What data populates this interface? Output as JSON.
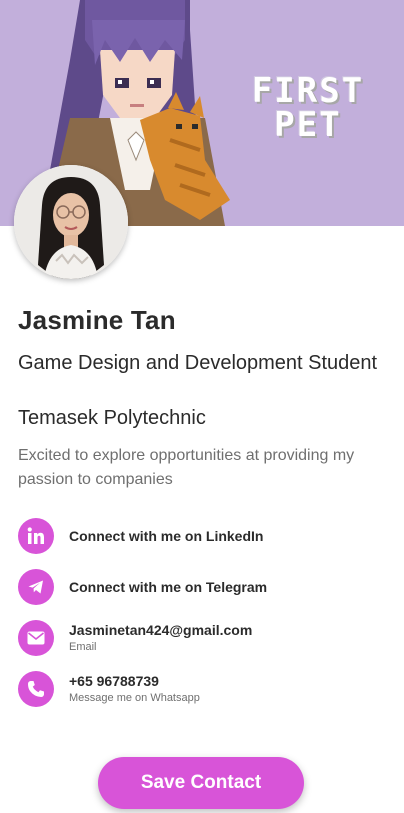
{
  "banner": {
    "title": "FIRST\nPET",
    "background_color": "#c2afdb"
  },
  "profile": {
    "name": "Jasmine Tan",
    "job_title": "Game Design and Development Student",
    "organization": "Temasek Polytechnic",
    "bio": "Excited to explore opportunities at providing my passion to companies"
  },
  "links": [
    {
      "icon": "linkedin-icon",
      "label": "Connect with me on LinkedIn",
      "sublabel": ""
    },
    {
      "icon": "telegram-icon",
      "label": "Connect with me on Telegram",
      "sublabel": ""
    },
    {
      "icon": "email-icon",
      "label": "Jasminetan424@gmail.com",
      "sublabel": "Email"
    },
    {
      "icon": "phone-icon",
      "label": "+65 96788739",
      "sublabel": "Message me on Whatsapp"
    }
  ],
  "actions": {
    "save_contact_label": "Save Contact"
  },
  "colors": {
    "accent": "#d854d8",
    "text_primary": "#2b2b2b",
    "text_secondary": "#6f6f6f"
  }
}
